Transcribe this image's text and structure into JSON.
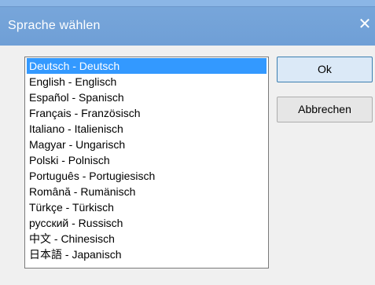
{
  "window": {
    "title": "Sprache wählen",
    "close_glyph": "✕"
  },
  "languages": [
    {
      "label": "Deutsch - Deutsch",
      "selected": true
    },
    {
      "label": "English - Englisch",
      "selected": false
    },
    {
      "label": "Español - Spanisch",
      "selected": false
    },
    {
      "label": "Français - Französisch",
      "selected": false
    },
    {
      "label": "Italiano - Italienisch",
      "selected": false
    },
    {
      "label": "Magyar - Ungarisch",
      "selected": false
    },
    {
      "label": "Polski - Polnisch",
      "selected": false
    },
    {
      "label": "Português - Portugiesisch",
      "selected": false
    },
    {
      "label": "Română - Rumänisch",
      "selected": false
    },
    {
      "label": "Türkçe - Türkisch",
      "selected": false
    },
    {
      "label": "русский - Russisch",
      "selected": false
    },
    {
      "label": "中文 - Chinesisch",
      "selected": false
    },
    {
      "label": "日本語 - Japanisch",
      "selected": false
    }
  ],
  "buttons": {
    "ok_label": "Ok",
    "cancel_label": "Abbrechen"
  },
  "colors": {
    "titlebar": "#79a7db",
    "selection": "#3399ff"
  }
}
